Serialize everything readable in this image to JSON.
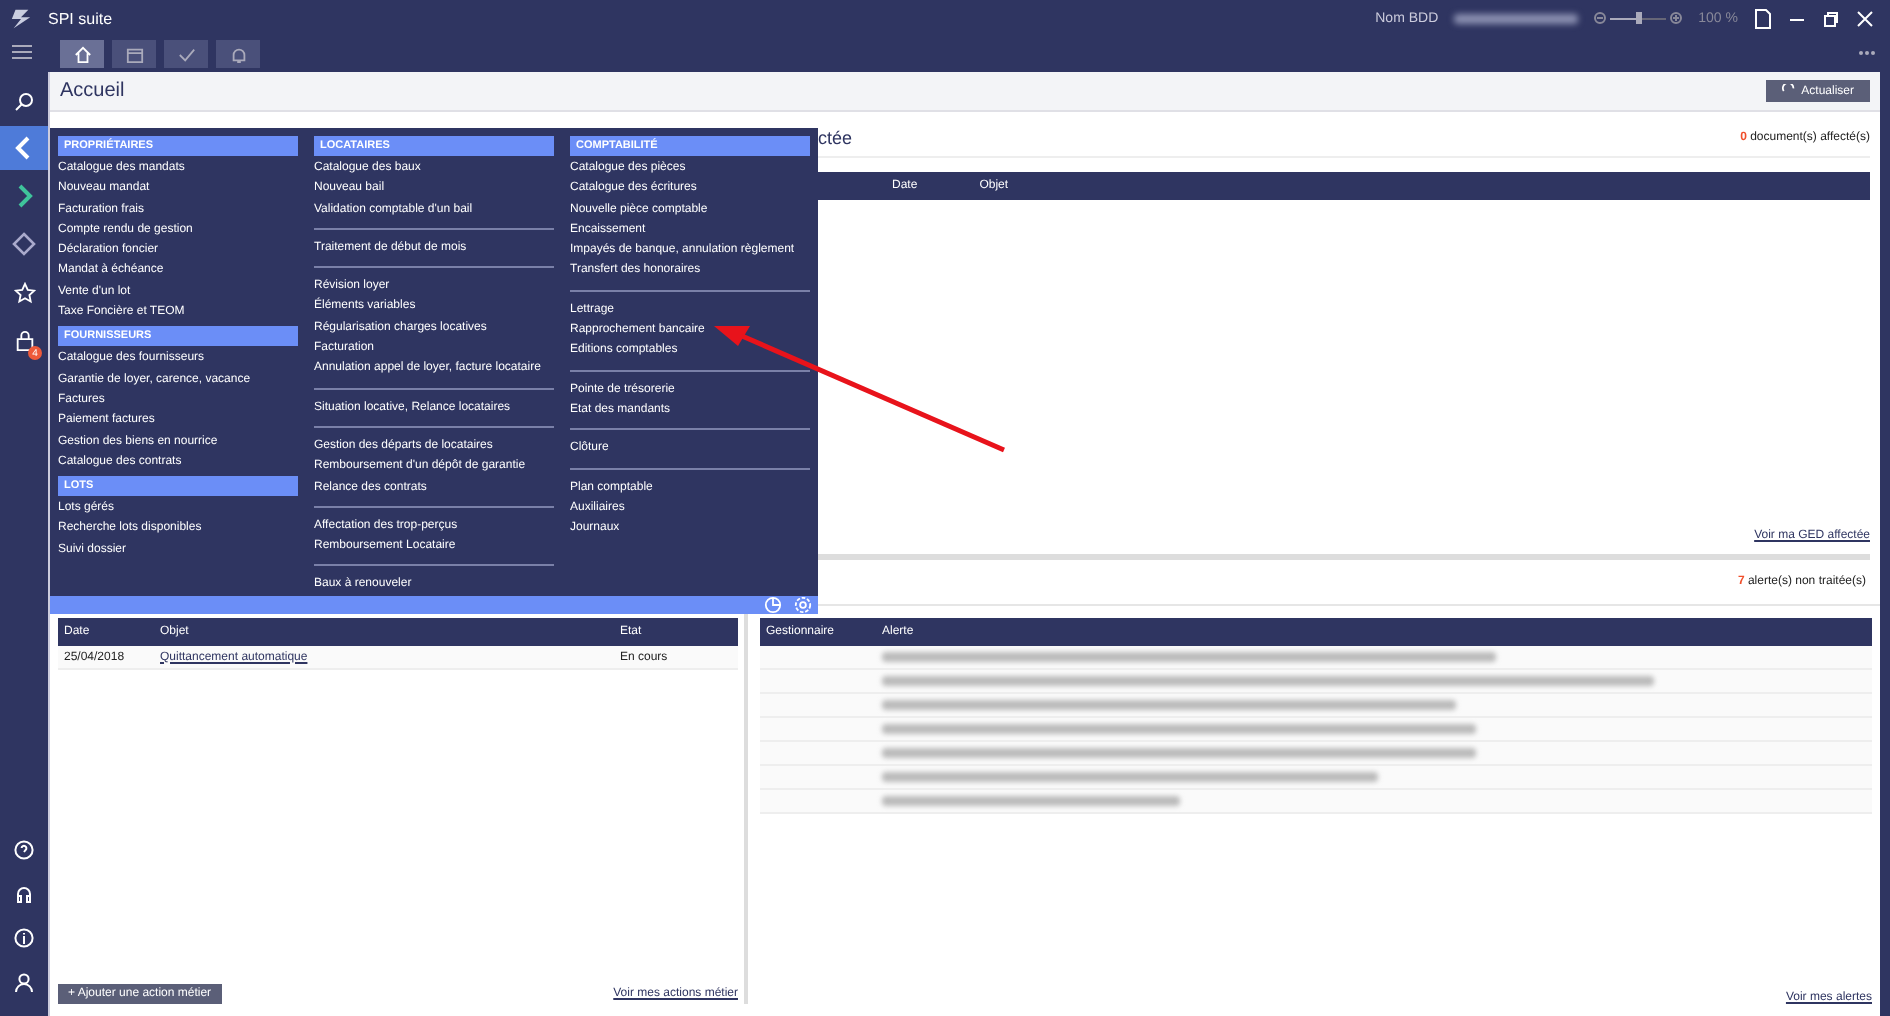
{
  "window": {
    "title": "SPI suite",
    "db_label": "Nom BDD",
    "zoom": {
      "level": 0.5,
      "reading": "100 %"
    }
  },
  "tabs": [
    {
      "kind": "home",
      "selected": true
    },
    {
      "kind": "calendar",
      "selected": false
    },
    {
      "kind": "check",
      "selected": false
    },
    {
      "kind": "bell",
      "selected": false
    }
  ],
  "sidebar": {
    "items": [
      {
        "kind": "back",
        "selected": true
      },
      {
        "kind": "forward",
        "selected": false
      },
      {
        "kind": "diamond",
        "selected": false
      },
      {
        "kind": "star",
        "selected": false
      },
      {
        "kind": "lock",
        "selected": false,
        "badge": "4"
      }
    ]
  },
  "page": {
    "title": "Accueil",
    "refresh_button": "Actualiser"
  },
  "menu": {
    "columns": [
      {
        "sections": [
          {
            "title": "PROPRIÉTAIRES",
            "groups": [
              [
                "Catalogue des mandats",
                "Nouveau mandat",
                "Facturation frais",
                "Compte rendu de gestion",
                "Déclaration foncier",
                "Mandat à échéance",
                "Vente d'un lot",
                "Taxe Foncière et TEOM"
              ]
            ]
          },
          {
            "title": "FOURNISSEURS",
            "groups": [
              [
                "Catalogue des fournisseurs",
                "Garantie de loyer, carence, vacance",
                "Factures",
                "Paiement factures",
                "Gestion des biens en nourrice",
                "Catalogue des contrats"
              ]
            ]
          },
          {
            "title": "LOTS",
            "groups": [
              [
                "Lots gérés",
                "Recherche lots disponibles",
                "Suivi dossier"
              ]
            ]
          }
        ]
      },
      {
        "sections": [
          {
            "title": "LOCATAIRES",
            "groups": [
              [
                "Catalogue des baux",
                "Nouveau bail",
                "Validation comptable d'un bail"
              ],
              [
                "Traitement de début de mois"
              ],
              [
                "Révision loyer",
                "Éléments variables",
                "Régularisation charges locatives",
                "Facturation",
                "Annulation appel de loyer, facture locataire"
              ],
              [
                "Situation locative, Relance locataires"
              ],
              [
                "Gestion des départs de locataires",
                "Remboursement d'un dépôt de garantie",
                "Relance des contrats"
              ],
              [
                "Affectation des trop-perçus",
                "Remboursement Locataire"
              ],
              [
                "Baux à renouveler"
              ]
            ]
          }
        ]
      },
      {
        "sections": [
          {
            "title": "COMPTABILITÉ",
            "groups": [
              [
                "Catalogue des pièces",
                "Catalogue des écritures",
                "Nouvelle pièce comptable",
                "Encaissement",
                "Impayés de banque, annulation règlement",
                "Transfert des honoraires"
              ],
              [
                "Lettrage",
                "Rapprochement bancaire",
                "Editions comptables"
              ],
              [
                "Pointe de trésorerie",
                "Etat des mandants"
              ],
              [
                "Clôture"
              ],
              [
                "Plan comptable",
                "Auxiliaires",
                "Journaux"
              ]
            ]
          }
        ]
      }
    ]
  },
  "ged": {
    "title": "ctée",
    "count": "0",
    "count_label": "document(s) affecté(s)",
    "columns": [
      "Date",
      "Objet"
    ],
    "link": "Voir ma GED affectée"
  },
  "alerts": {
    "count": "7",
    "count_label": "alerte(s) non traitée(s)",
    "columns": [
      "Gestionnaire",
      "Alerte"
    ],
    "link": "Voir mes alertes"
  },
  "actions": {
    "columns": [
      "Date",
      "Objet",
      "Etat"
    ],
    "rows": [
      {
        "date": "25/04/2018",
        "object": "Quittancement automatique",
        "state": "En cours"
      }
    ],
    "add_button": "+ Ajouter une action métier",
    "link": "Voir mes actions métier"
  }
}
